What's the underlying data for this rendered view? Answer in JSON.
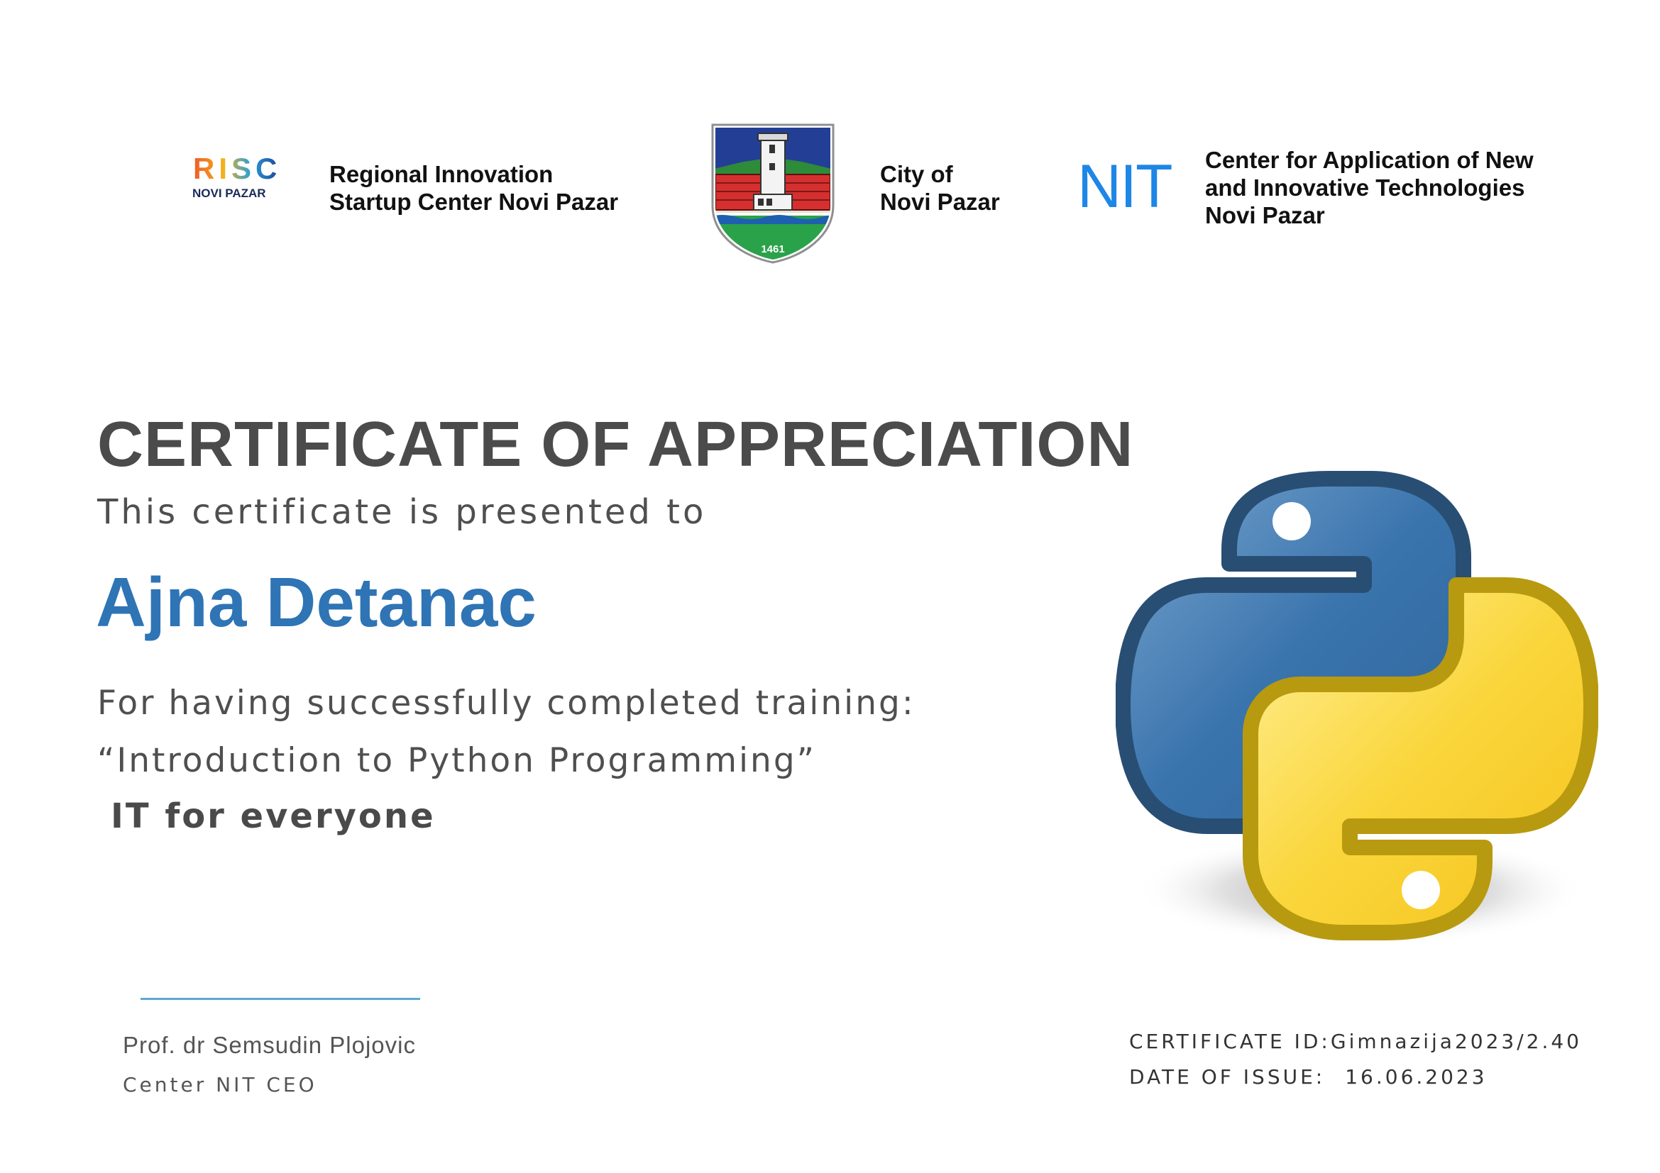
{
  "header": {
    "risc": {
      "logo_text": "RISC",
      "logo_subtext": "NOVI PAZAR",
      "name_lines": [
        "Regional Innovation",
        "Startup Center Novi Pazar"
      ]
    },
    "city": {
      "crest_year": "1461",
      "name_lines": [
        "City of",
        "Novi Pazar"
      ]
    },
    "nit": {
      "logo_text": "NIT",
      "name_lines": [
        "Center for Application of New",
        "and Innovative Technologies",
        "Novi Pazar"
      ]
    }
  },
  "certificate": {
    "title": "CERTIFICATE OF APPRECIATION",
    "subtitle": "This certificate is presented to",
    "recipient": "Ajna Detanac",
    "completion_text": "For having successfully completed training:",
    "course": "“Introduction to Python Programming”",
    "program": "IT for everyone"
  },
  "signature": {
    "name": "Prof. dr Semsudin Plojovic",
    "role": "Center NIT CEO"
  },
  "meta": {
    "certificate_id_label": "CERTIFICATE ID:",
    "certificate_id": "Gimnazija2023/2.40",
    "date_label": "DATE OF ISSUE:",
    "date": "16.06.2023"
  },
  "colors": {
    "title": "#4b4b4b",
    "recipient": "#2f74b5",
    "python_blue": "#3a6f9f",
    "python_yellow": "#f7cf3a",
    "nit_blue": "#1e86e6",
    "signature_line": "#5aa9d6"
  },
  "icons": {
    "python_logo": "python-logo-icon",
    "city_crest": "city-crest-icon"
  }
}
